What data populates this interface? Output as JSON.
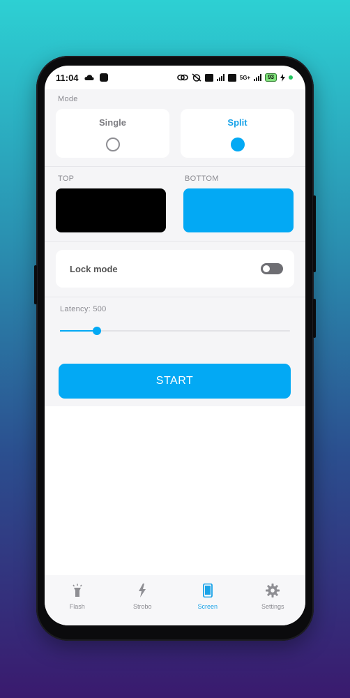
{
  "status_bar": {
    "time": "11:04",
    "network": "5G+",
    "battery": "93"
  },
  "mode": {
    "label": "Mode",
    "options": [
      {
        "label": "Single",
        "selected": false
      },
      {
        "label": "Split",
        "selected": true
      }
    ]
  },
  "colors": {
    "top_label": "TOP",
    "bottom_label": "BOTTOM",
    "top_color": "#000000",
    "bottom_color": "#03a9f4"
  },
  "lock_mode": {
    "label": "Lock mode",
    "enabled": false
  },
  "latency": {
    "label": "Latency:",
    "value": "500",
    "fraction": 0.16
  },
  "start_label": "START",
  "nav": {
    "items": [
      {
        "label": "Flash",
        "icon": "flashlight-icon",
        "active": false
      },
      {
        "label": "Strobo",
        "icon": "bolt-icon",
        "active": false
      },
      {
        "label": "Screen",
        "icon": "phone-screen-icon",
        "active": true
      },
      {
        "label": "Settings",
        "icon": "gear-icon",
        "active": false
      }
    ]
  },
  "accent_color": "#03a9f4"
}
